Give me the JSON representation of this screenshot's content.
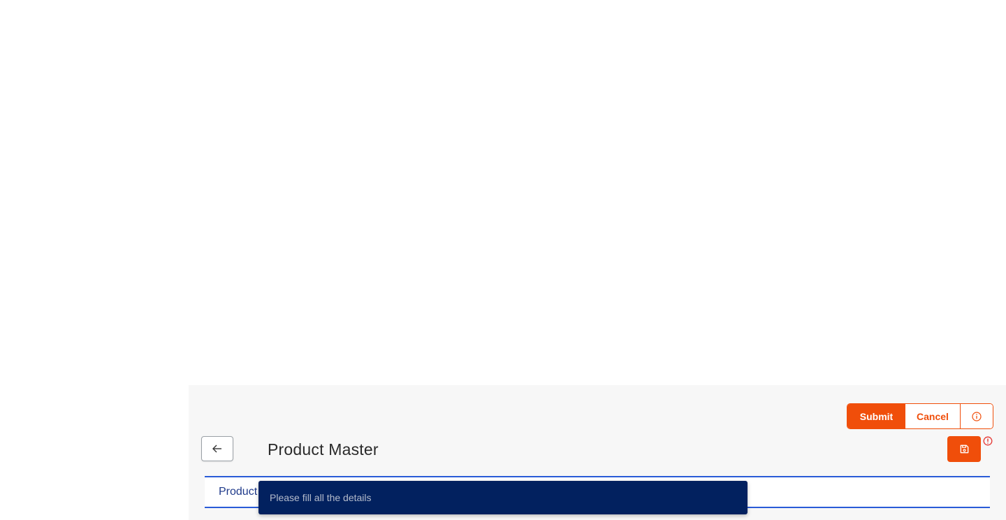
{
  "header": {
    "title": "Product Master",
    "back_icon": "arrow-left-icon"
  },
  "actions": {
    "submit_label": "Submit",
    "cancel_label": "Cancel",
    "info_icon": "info-circle-icon",
    "save_icon": "floppy-disk-icon",
    "warning_icon": "exclamation-circle-icon"
  },
  "tabs": [
    {
      "label": "Product"
    }
  ],
  "toast": {
    "message": "Please fill all the details"
  },
  "colors": {
    "accent": "#f04e0a",
    "tab_border": "#2a5bd7",
    "tab_text": "#1f3a8a",
    "toast_bg": "#02215f",
    "toast_text": "#b5bccc",
    "warning": "#e53935"
  }
}
